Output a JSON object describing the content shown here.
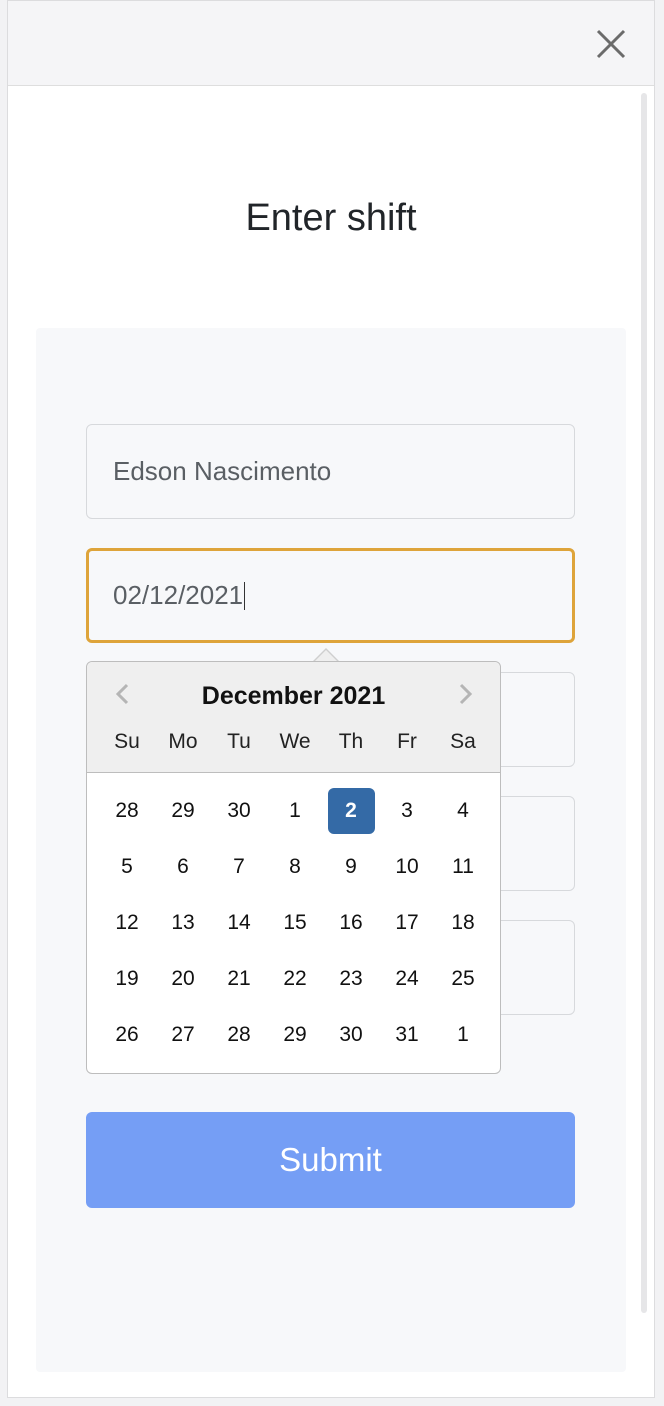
{
  "dialog": {
    "title": "Enter shift"
  },
  "icons": {
    "close": "close-icon",
    "prev": "chevron-left-icon",
    "next": "chevron-right-icon"
  },
  "form": {
    "name_value": "Edson Nascimento",
    "date_value": "02/12/2021",
    "submit_label": "Submit"
  },
  "datepicker": {
    "month_label": "December 2021",
    "weekdays": [
      "Su",
      "Mo",
      "Tu",
      "We",
      "Th",
      "Fr",
      "Sa"
    ],
    "weeks": [
      [
        "28",
        "29",
        "30",
        "1",
        "2",
        "3",
        "4"
      ],
      [
        "5",
        "6",
        "7",
        "8",
        "9",
        "10",
        "11"
      ],
      [
        "12",
        "13",
        "14",
        "15",
        "16",
        "17",
        "18"
      ],
      [
        "19",
        "20",
        "21",
        "22",
        "23",
        "24",
        "25"
      ],
      [
        "26",
        "27",
        "28",
        "29",
        "30",
        "31",
        "1"
      ]
    ],
    "selected_day": "2"
  },
  "colors": {
    "accent_focus": "#dea43a",
    "selected_day": "#346aa6",
    "submit": "#759ef5"
  }
}
